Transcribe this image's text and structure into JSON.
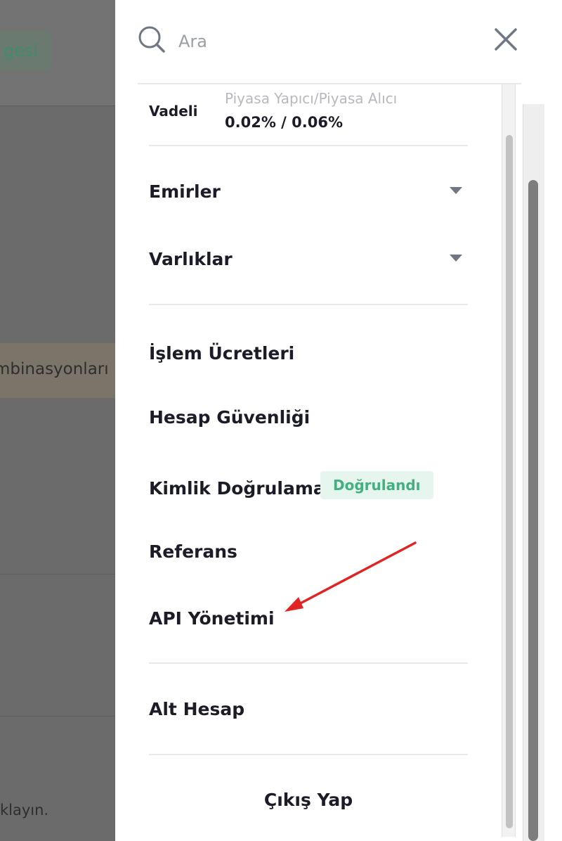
{
  "background": {
    "pill_text": "gesi",
    "combo_text": "mbinasyonları",
    "click_text": "klayın."
  },
  "search": {
    "placeholder": "Ara"
  },
  "fees": {
    "label": "Vadeli",
    "sub": "Piyasa Yapıcı/Piyasa Alıcı",
    "value": "0.02% / 0.06%"
  },
  "menu": {
    "orders": "Emirler",
    "assets": "Varlıklar",
    "trading_fees": "İşlem Ücretleri",
    "account_security": "Hesap Güvenliği",
    "identity_verification": "Kimlik Doğrulama",
    "verified_badge": "Doğrulandı",
    "referral": "Referans",
    "api_management": "API Yönetimi",
    "sub_account": "Alt Hesap",
    "logout": "Çıkış Yap"
  },
  "colors": {
    "accent_green": "#44b07f",
    "annotation_arrow": "#e02424"
  }
}
